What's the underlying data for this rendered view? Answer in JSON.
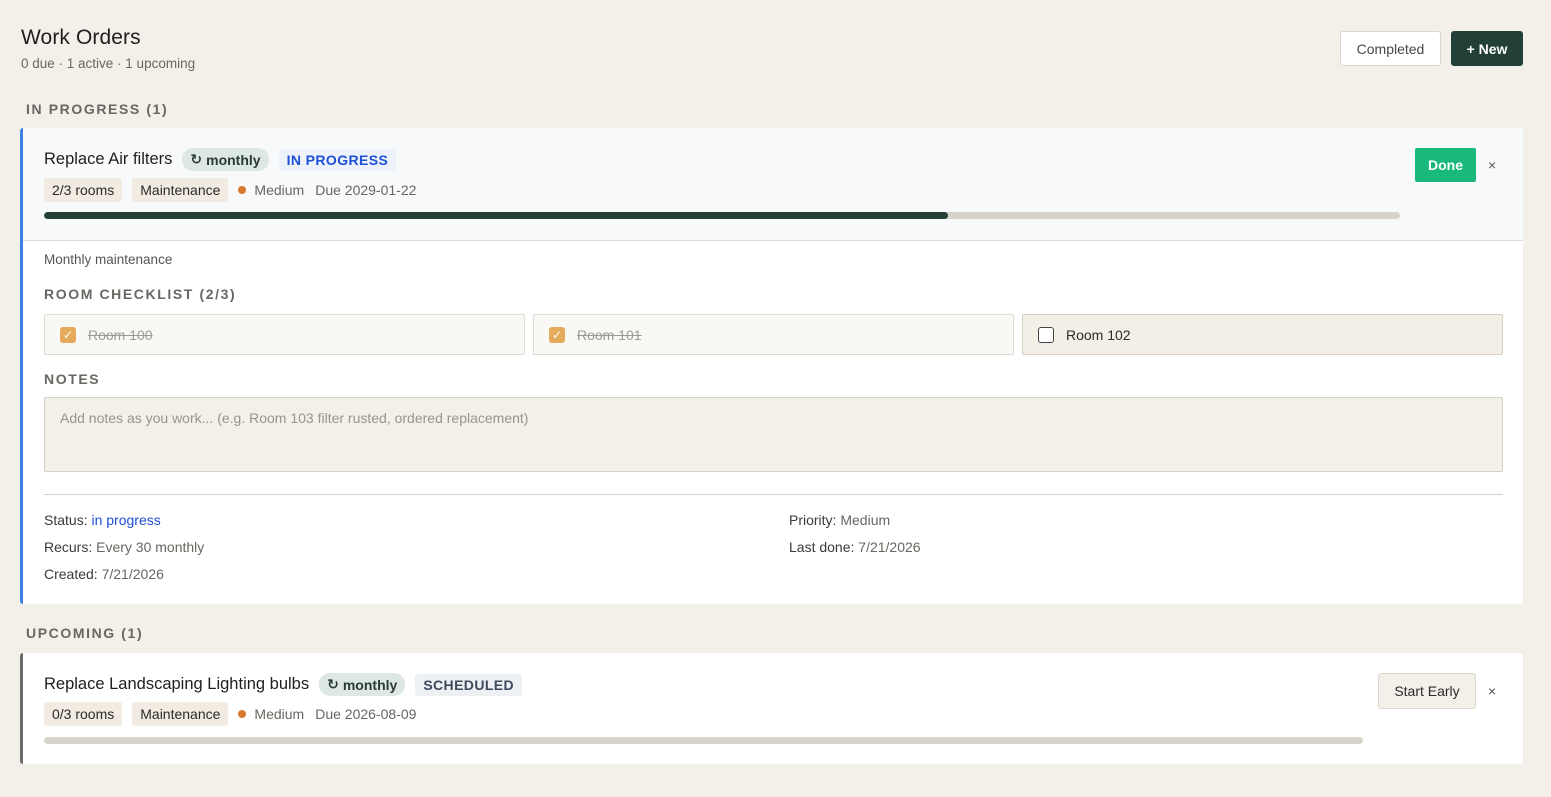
{
  "header": {
    "title": "Work Orders",
    "subtitle": "0 due · 1 active · 1 upcoming",
    "completed_label": "Completed",
    "new_label": "+ New"
  },
  "sections": {
    "in_progress_label": "IN PROGRESS (1)",
    "upcoming_label": "UPCOMING (1)"
  },
  "active_order": {
    "title": "Replace Air filters",
    "recur_icon": "↻",
    "recur_label": "monthly",
    "status_badge": "IN PROGRESS",
    "rooms_chip": "2/3 rooms",
    "category_chip": "Maintenance",
    "priority": "Medium",
    "due": "Due 2029-01-22",
    "progress": 0.6667,
    "done_label": "Done",
    "close_label": "×",
    "description": "Monthly maintenance",
    "checklist_label": "ROOM CHECKLIST (2/3)",
    "rooms": [
      {
        "label": "Room 100",
        "checked": true
      },
      {
        "label": "Room 101",
        "checked": true
      },
      {
        "label": "Room 102",
        "checked": false
      }
    ],
    "notes_label": "NOTES",
    "notes_placeholder": "Add notes as you work... (e.g. Room 103 filter rusted, ordered replacement)",
    "details": {
      "status_key": "Status:",
      "status_value": "in progress",
      "recurs_key": "Recurs:",
      "recurs_value": "Every 30 monthly",
      "created_key": "Created:",
      "created_value": "7/21/2026",
      "priority_key": "Priority:",
      "priority_value": "Medium",
      "last_done_key": "Last done:",
      "last_done_value": "7/21/2026"
    }
  },
  "upcoming_order": {
    "title": "Replace Landscaping Lighting bulbs",
    "recur_icon": "↻",
    "recur_label": "monthly",
    "status_badge": "SCHEDULED",
    "rooms_chip": "0/3 rooms",
    "category_chip": "Maintenance",
    "priority": "Medium",
    "due": "Due 2026-08-09",
    "progress": 0,
    "start_label": "Start Early",
    "close_label": "×"
  },
  "colors": {
    "accent_dark": "#234038",
    "done_green": "#18b97b",
    "in_progress_blue": "#1d4fd8",
    "priority_orange": "#d9772a",
    "checkbox_orange": "#e6aa5c"
  }
}
